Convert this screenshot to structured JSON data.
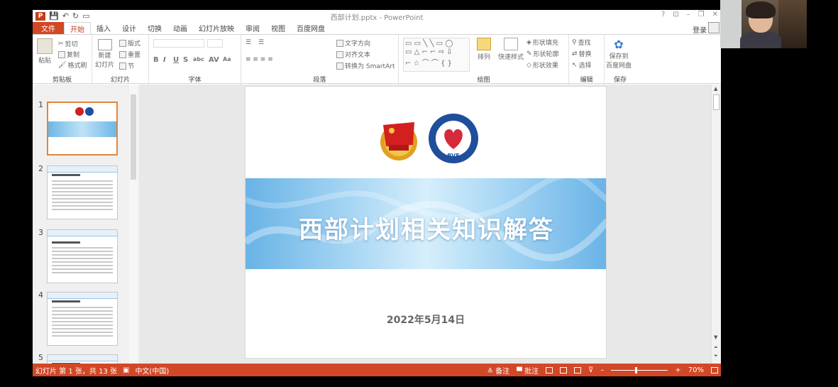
{
  "window": {
    "doc_title": "西部计划.pptx - PowerPoint",
    "controls": [
      "?",
      "⊡",
      "–",
      "❐",
      "✕"
    ]
  },
  "tabs": [
    "文件",
    "开始",
    "插入",
    "设计",
    "切换",
    "动画",
    "幻灯片放映",
    "审阅",
    "视图",
    "百度网盘"
  ],
  "login": "登录",
  "ribbon": {
    "clipboard": {
      "paste": "粘贴",
      "cut": "剪切",
      "copy": "复制",
      "format_painter": "格式刷",
      "label": "剪贴板"
    },
    "slides": {
      "new_slide": "新建",
      "new_slide2": "幻灯片",
      "layout": "版式",
      "reset": "重置",
      "section": "节",
      "label": "幻灯片"
    },
    "font": {
      "label": "字体"
    },
    "paragraph": {
      "text_direction": "文字方向",
      "align_text": "对齐文本",
      "smartart": "转换为 SmartArt",
      "label": "段落"
    },
    "drawing": {
      "arrange": "排列",
      "quick_styles": "快速样式",
      "shape_fill": "形状填充",
      "shape_outline": "形状轮廓",
      "shape_effects": "形状效果",
      "label": "绘图"
    },
    "editing": {
      "find": "查找",
      "replace": "替换",
      "select": "选择",
      "label": "编辑"
    },
    "save": {
      "save_to": "保存到",
      "baidu": "百度网盘",
      "label": "保存"
    }
  },
  "thumbnails": [
    "1",
    "2",
    "3",
    "4",
    "5"
  ],
  "slide": {
    "title": "西部计划相关知识解答",
    "date": "2022年5月14日",
    "logo_text": "BVF"
  },
  "status": {
    "slide_info": "幻灯片 第 1 张，共 13 张",
    "language": "中文(中国)",
    "notes": "备注",
    "comments": "批注",
    "zoom": "70%"
  },
  "colors": {
    "accent": "#d24726",
    "band": "#69b3e6"
  }
}
